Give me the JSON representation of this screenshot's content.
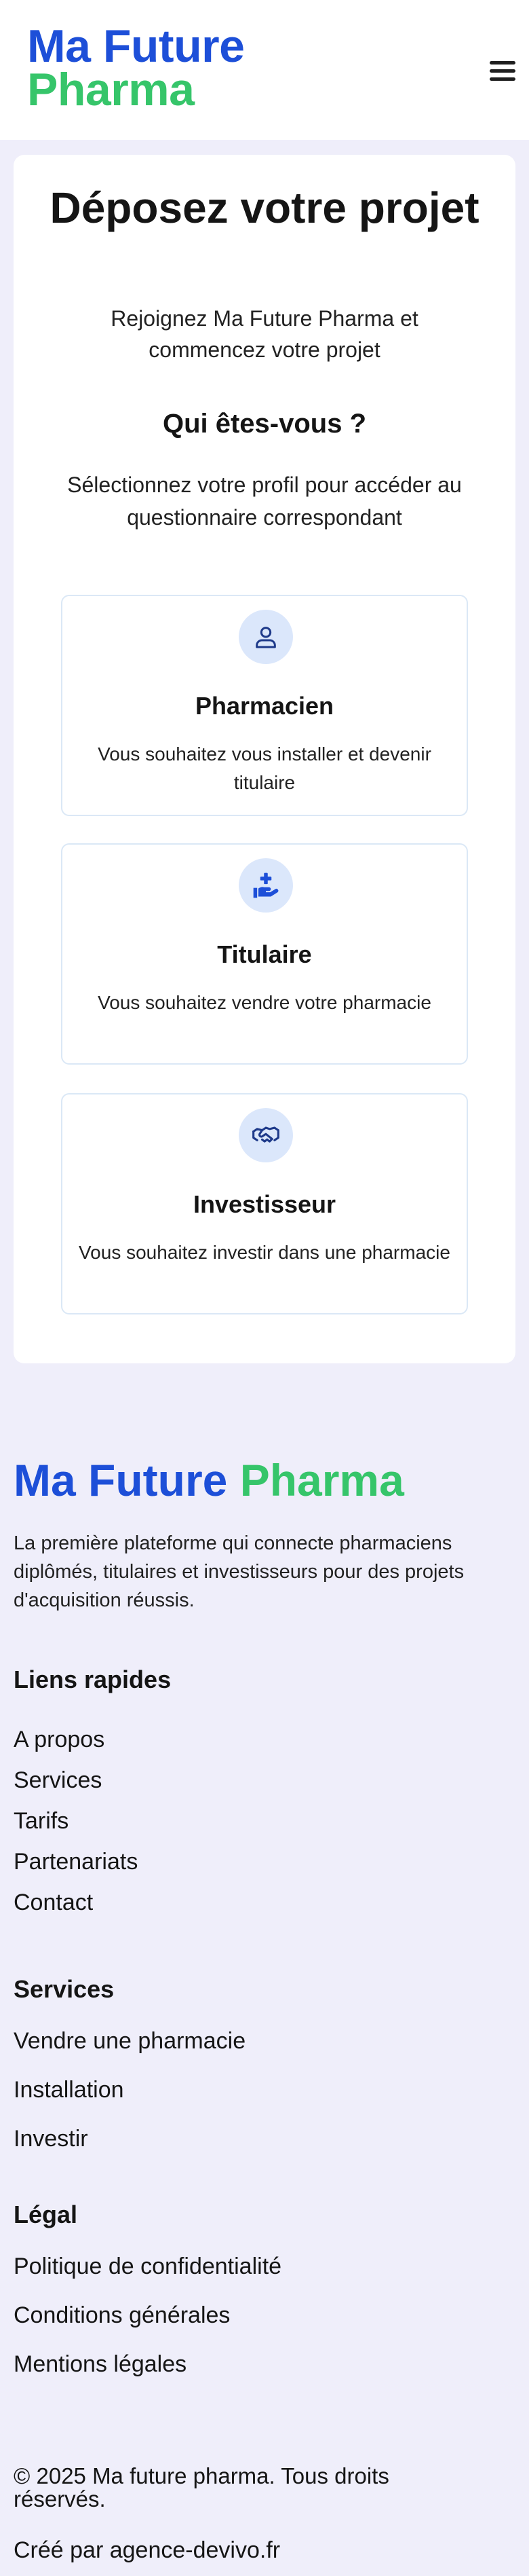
{
  "header": {
    "logo_part1": "Ma Future",
    "logo_part2": "Pharma",
    "menu_icon": "hamburger-menu-icon"
  },
  "main": {
    "title": "Déposez votre projet",
    "subtitle": "Rejoignez Ma Future Pharma et commencez votre projet",
    "question": "Qui êtes-vous ?",
    "instruction": "Sélectionnez votre profil pour accéder au questionnaire correspondant",
    "profiles": [
      {
        "icon": "user-icon",
        "name": "Pharmacien",
        "description": "Vous souhaitez vous installer et devenir titulaire"
      },
      {
        "icon": "hand-plus-icon",
        "name": "Titulaire",
        "description": "Vous souhaitez vendre votre pharmacie"
      },
      {
        "icon": "handshake-icon",
        "name": "Investisseur",
        "description": "Vous souhaitez investir dans une pharmacie"
      }
    ]
  },
  "footer": {
    "logo_part1": "Ma Future",
    "logo_part2": "Pharma",
    "description": "La première plateforme qui connecte pharmaciens diplômés, titulaires et investisseurs pour des projets d'acquisition réussis.",
    "quick_links_title": "Liens rapides",
    "quick_links": [
      "A propos",
      "Services",
      "Tarifs",
      "Partenariats",
      "Contact"
    ],
    "services_title": "Services",
    "services": [
      "Vendre une pharmacie",
      "Installation",
      "Investir"
    ],
    "legal_title": "Légal",
    "legal": [
      "Politique de confidentialité",
      "Conditions générales",
      "Mentions légales"
    ],
    "copyright": "© 2025 Ma future pharma. Tous droits réservés.",
    "credit": "Créé par agence-devivo.fr"
  },
  "colors": {
    "brand_blue": "#1d4fd8",
    "brand_green": "#36c56a",
    "page_bg": "#efeefa"
  }
}
